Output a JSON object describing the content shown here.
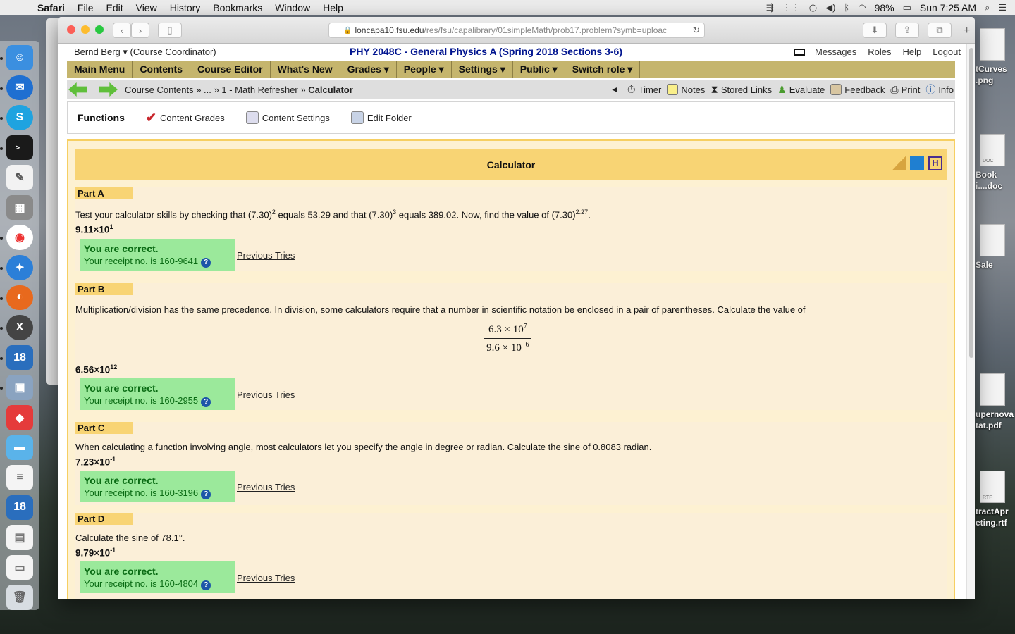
{
  "menubar": {
    "apple": "",
    "items": [
      "Safari",
      "File",
      "Edit",
      "View",
      "History",
      "Bookmarks",
      "Window",
      "Help"
    ],
    "battery": "98%",
    "clock": "Sun 7:25 AM"
  },
  "desktop": {
    "files": [
      {
        "label": "tCurves\n.png"
      },
      {
        "label": "DOC"
      },
      {
        "label": "Book\ni....doc"
      },
      {
        "label": "Sale"
      },
      {
        "label": "upernova\ntat.pdf"
      },
      {
        "label": "RTF"
      },
      {
        "label": "tractApr\neting.rtf"
      }
    ]
  },
  "browser": {
    "url_prefix": "loncapa10.fsu.edu",
    "url_path": "/res/fsu/capalibrary/01simpleMath/prob17.problem?symb=uploac"
  },
  "page": {
    "user": "Bernd Berg ▾",
    "role": "(Course Coordinator)",
    "course_title": "PHY 2048C - General Physics A (Spring 2018 Sections 3-6)",
    "top_links": [
      "Messages",
      "Roles",
      "Help",
      "Logout"
    ],
    "main_menu": [
      "Main Menu",
      "Contents",
      "Course Editor",
      "What's New",
      "Grades ▾",
      "People ▾",
      "Settings ▾",
      "Public ▾",
      "Switch role ▾"
    ],
    "breadcrumb": {
      "c1": "Course Contents",
      "sep1": "»",
      "c2": "...",
      "sep2": "»",
      "c3": "1 - Math Refresher",
      "sep3": "»",
      "current": "Calculator"
    },
    "tools": [
      "Timer",
      "Notes",
      "Stored Links",
      "Evaluate",
      "Feedback",
      "Print",
      "Info"
    ],
    "functions_label": "Functions",
    "functions": [
      "Content Grades",
      "Content Settings",
      "Edit Folder"
    ],
    "problem_title": "Calculator",
    "parts": [
      {
        "tag": "Part A",
        "text_pre": "Test your calculator skills by checking that (7.30)",
        "exp1": "2",
        "text_mid1": " equals 53.29 and that (7.30)",
        "exp2": "3",
        "text_mid2": " equals 389.02. Now, find the value of (7.30)",
        "exp3": "2.27",
        "text_end": ".",
        "answer_base": "9.11×10",
        "answer_exp": "1",
        "status": "You are correct.",
        "receipt": "Your receipt no. is 160-9641",
        "prev": "Previous Tries"
      },
      {
        "tag": "Part B",
        "text": "Multiplication/division has the same precedence. In division, some calculators require that a number in scientific notation be enclosed in a pair of parentheses. Calculate the value of",
        "num_base": "6.3 × 10",
        "num_exp": "7",
        "den_base": "9.6 × 10",
        "den_exp": "−6",
        "answer_base": "6.56×10",
        "answer_exp": "12",
        "status": "You are correct.",
        "receipt": "Your receipt no. is 160-2955",
        "prev": "Previous Tries"
      },
      {
        "tag": "Part C",
        "text": "When calculating a function involving angle, most calculators let you specify the angle in degree or radian. Calculate the sine of 0.8083 radian.",
        "answer_base": "7.23×10",
        "answer_exp": "-1",
        "status": "You are correct.",
        "receipt": "Your receipt no. is 160-3196",
        "prev": "Previous Tries"
      },
      {
        "tag": "Part D",
        "text": "Calculate the sine of 78.1°.",
        "answer_base": "9.79×10",
        "answer_exp": "-1",
        "status": "You are correct.",
        "receipt": "Your receipt no. is 160-4804",
        "prev": "Previous Tries"
      }
    ],
    "help_glyph": "?"
  }
}
